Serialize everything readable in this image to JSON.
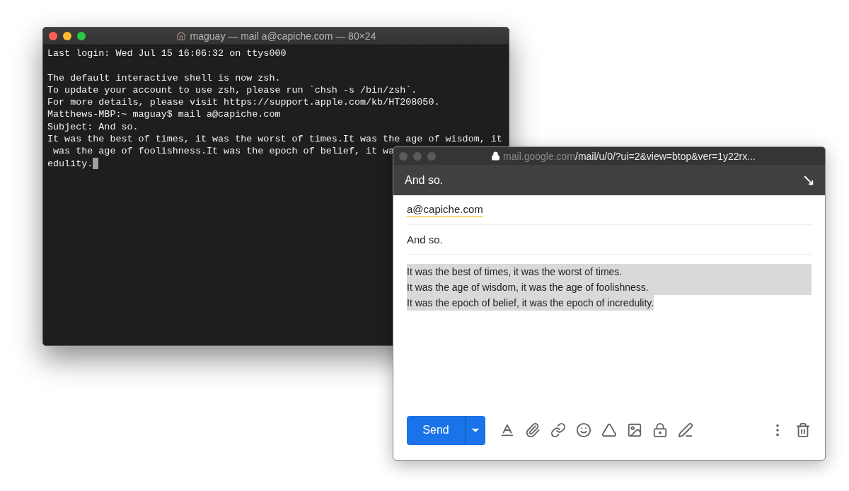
{
  "terminal": {
    "title": "maguay — mail a@capiche.com — 80×24",
    "blocks": [
      [
        "Last login: Wed Jul 15 16:06:32 on ttys000"
      ],
      [
        "The default interactive shell is now zsh.",
        "To update your account to use zsh, please run `chsh -s /bin/zsh`.",
        "For more details, please visit https://support.apple.com/kb/HT208050.",
        "Matthews-MBP:~ maguay$ mail a@capiche.com",
        "Subject: And so.",
        "It was the best of times, it was the worst of times.It was the age of wisdom, it",
        " was the age of foolishness.It was the epoch of belief, it wa",
        "edulity."
      ]
    ]
  },
  "mail": {
    "url_host": "mail.google.com",
    "url_path": "/mail/u/0/?ui=2&view=btop&ver=1y22rx...",
    "header": "And so.",
    "to": "a@capiche.com",
    "subject": "And so.",
    "body": {
      "selected": true,
      "lines": [
        "It was the best of times, it was the worst of times.",
        "It was the age of wisdom, it was the age of foolishness.",
        "It was the epoch of belief, it was the epoch of incredulity."
      ]
    },
    "send": "Send"
  }
}
